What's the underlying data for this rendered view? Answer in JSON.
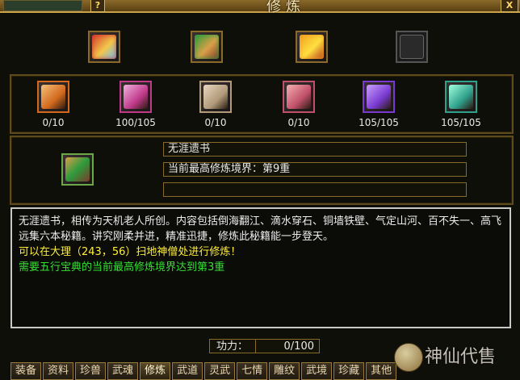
{
  "window": {
    "title": "修炼",
    "help": "?",
    "close": "X"
  },
  "top_icons": [
    {
      "name": "book-red-icon",
      "colors": [
        "#d33b2b",
        "#f3c64a",
        "#6ac0ff"
      ]
    },
    {
      "name": "scroll-bundle-green-icon",
      "colors": [
        "#2d9b3d",
        "#d9a048",
        "#7a3a2a"
      ]
    },
    {
      "name": "gold-bundle-icon",
      "colors": [
        "#f0a020",
        "#ffdf40",
        "#b33a1a"
      ]
    },
    {
      "name": "empty-slot-icon",
      "colors": [
        "#2a2a2a"
      ]
    }
  ],
  "skills": [
    {
      "icon": "scroll-orange-icon",
      "colors": [
        "#d2691e",
        "#f3c27a"
      ],
      "progress": "0/10"
    },
    {
      "icon": "scroll-purple-icon",
      "colors": [
        "#c03a8a",
        "#f0b0e0"
      ],
      "progress": "100/105"
    },
    {
      "icon": "scroll-beige-icon",
      "colors": [
        "#b29a7a",
        "#e6d6c0"
      ],
      "progress": "0/10"
    },
    {
      "icon": "scroll-pink-icon",
      "colors": [
        "#c0506a",
        "#f3b0b0"
      ],
      "progress": "0/10"
    },
    {
      "icon": "scroll-violet-icon",
      "colors": [
        "#7a3ad0",
        "#c8a0ff"
      ],
      "progress": "105/105"
    },
    {
      "icon": "scroll-teal-icon",
      "colors": [
        "#2fa08a",
        "#a0ffe0"
      ],
      "progress": "105/105"
    }
  ],
  "selected": {
    "icon": "scroll-bundle-green-icon",
    "name": "无涯遗书",
    "realm": "当前最高修炼境界：第9重",
    "extra": ""
  },
  "description": {
    "text": "无涯遗书，相传为天机老人所创。内容包括倒海翻江、滴水穿石、铜墙铁壁、气定山河、百不失一、高飞远集六本秘籍。讲究刚柔并进，精准迅捷，修炼此秘籍能一步登天。",
    "location_hint": "可以在大理（243，56）扫地神僧处进行修炼！",
    "requirement": "需要五行宝典的当前最高修炼境界达到第3重"
  },
  "power": {
    "label": "功力：",
    "value": "0/100"
  },
  "tabs": [
    "装备",
    "资料",
    "珍兽",
    "武魂",
    "修炼",
    "武道",
    "灵武",
    "七情",
    "雕纹",
    "武境",
    "珍藏",
    "其他"
  ],
  "active_tab": "修炼",
  "watermark": "神仙代售"
}
